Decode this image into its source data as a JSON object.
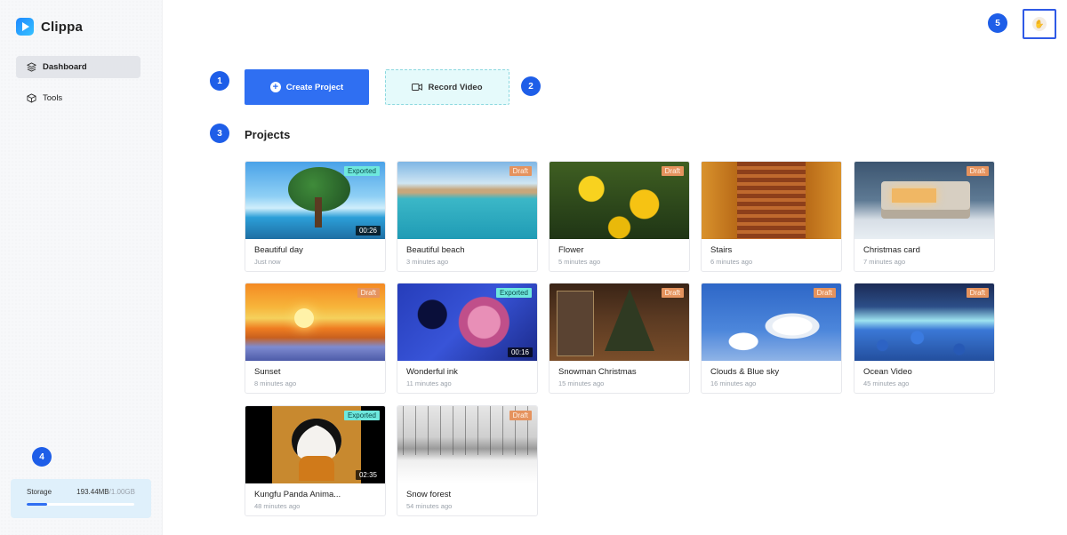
{
  "app": {
    "name": "Clippa"
  },
  "colors": {
    "accent": "#2f6ff2",
    "marker": "#1e5ee8",
    "exported_badge": "#6ee8dd",
    "draft_badge": "#e5935e"
  },
  "sidebar": {
    "items": [
      {
        "label": "Dashboard",
        "icon": "layers-icon",
        "active": true
      },
      {
        "label": "Tools",
        "icon": "box-icon",
        "active": false
      }
    ]
  },
  "storage": {
    "label": "Storage",
    "used": "193.44MB",
    "total": "/1.00GB",
    "fill_fraction": 0.19
  },
  "markers": [
    "1",
    "2",
    "3",
    "4",
    "5"
  ],
  "actions": {
    "create_label": "Create Project",
    "record_label": "Record Video"
  },
  "projects": {
    "title": "Projects",
    "items": [
      {
        "name": "Beautiful day",
        "time": "Just now",
        "status": "Exported",
        "duration": "00:26"
      },
      {
        "name": "Beautiful beach",
        "time": "3 minutes ago",
        "status": "Draft",
        "duration": ""
      },
      {
        "name": "Flower",
        "time": "5 minutes ago",
        "status": "Draft",
        "duration": ""
      },
      {
        "name": "Stairs",
        "time": "6 minutes ago",
        "status": "Draft",
        "duration": ""
      },
      {
        "name": "Christmas card",
        "time": "7 minutes ago",
        "status": "Draft",
        "duration": ""
      },
      {
        "name": "Sunset",
        "time": "8 minutes ago",
        "status": "Draft",
        "duration": ""
      },
      {
        "name": "Wonderful ink",
        "time": "11 minutes ago",
        "status": "Exported",
        "duration": "00:16"
      },
      {
        "name": "Snowman Christmas",
        "time": "15 minutes ago",
        "status": "Draft",
        "duration": ""
      },
      {
        "name": "Clouds & Blue sky",
        "time": "16 minutes ago",
        "status": "Draft",
        "duration": ""
      },
      {
        "name": "Ocean Video",
        "time": "45 minutes ago",
        "status": "Draft",
        "duration": ""
      },
      {
        "name": "Kungfu Panda Anima...",
        "time": "48 minutes ago",
        "status": "Exported",
        "duration": "02:35"
      },
      {
        "name": "Snow forest",
        "time": "54 minutes ago",
        "status": "Draft",
        "duration": ""
      }
    ]
  }
}
